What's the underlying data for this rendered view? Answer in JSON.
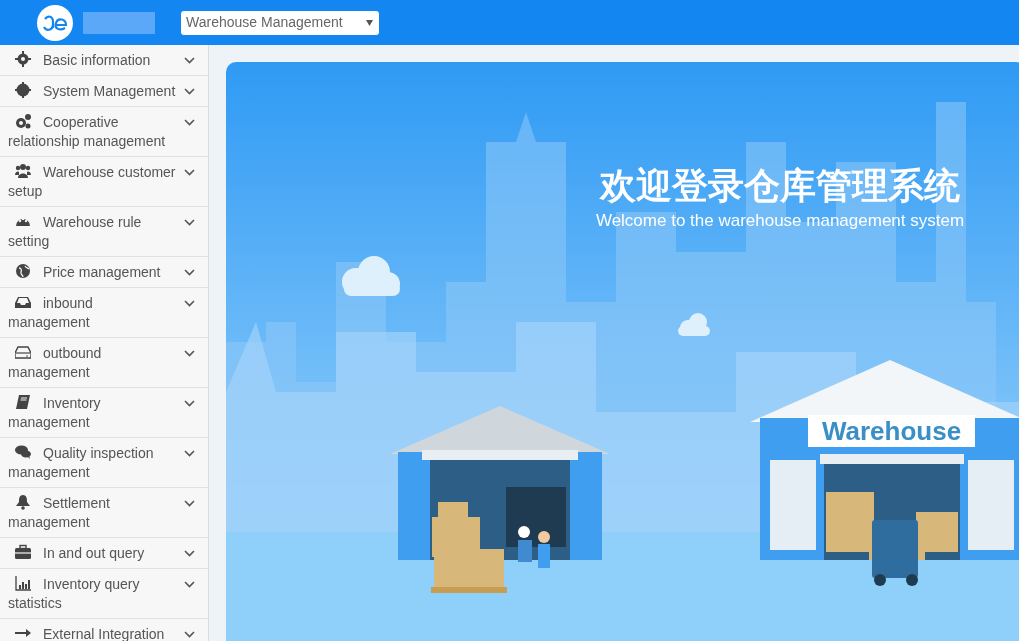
{
  "header": {
    "module_select": {
      "value": "Warehouse Management"
    }
  },
  "sidebar": {
    "items": [
      {
        "label": "Basic information"
      },
      {
        "label": "System Management"
      },
      {
        "label": "Cooperative relationship management"
      },
      {
        "label": "Warehouse customer setup"
      },
      {
        "label": "Warehouse rule setting"
      },
      {
        "label": "Price management"
      },
      {
        "label": "inbound management"
      },
      {
        "label": "outbound management"
      },
      {
        "label": "Inventory management"
      },
      {
        "label": "Quality inspection management"
      },
      {
        "label": "Settlement management"
      },
      {
        "label": "In and out query"
      },
      {
        "label": "Inventory query statistics"
      },
      {
        "label": "External Integration"
      }
    ]
  },
  "banner": {
    "title": "欢迎登录仓库管理系统",
    "subtitle": "Welcome to the warehouse management system",
    "sign": "Warehouse"
  }
}
